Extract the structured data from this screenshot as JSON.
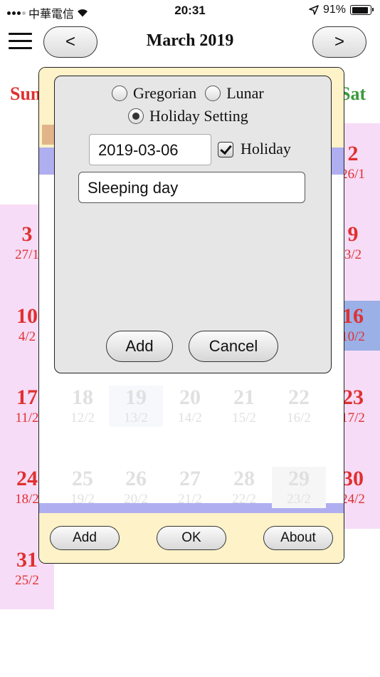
{
  "status_bar": {
    "carrier": "中華電信",
    "time": "20:31",
    "battery": "91%",
    "battery_level": 0.91
  },
  "header": {
    "prev_label": "<",
    "next_label": ">",
    "title": "March 2019"
  },
  "calendar": {
    "dow_sun": "Sun",
    "dow_sat": "Sat",
    "colors": {
      "weekend_bg": "#f6dcf6",
      "holiday_red": "#e03030",
      "sat_green": "#3a9a3a",
      "highlight_blue": "#9ab0e6"
    },
    "sundays": [
      {
        "day": "3",
        "lunar": "27/1"
      },
      {
        "day": "10",
        "lunar": "4/2"
      },
      {
        "day": "17",
        "lunar": "11/2"
      },
      {
        "day": "24",
        "lunar": "18/2"
      },
      {
        "day": "31",
        "lunar": "25/2"
      }
    ],
    "saturdays": [
      {
        "day": "2",
        "lunar": "26/1"
      },
      {
        "day": "9",
        "lunar": "3/2"
      },
      {
        "day": "16",
        "lunar": "10/2"
      },
      {
        "day": "23",
        "lunar": "17/2"
      },
      {
        "day": "30",
        "lunar": "24/2"
      }
    ],
    "faded_weeks": [
      [
        {
          "day": "18",
          "lunar": "12/2"
        },
        {
          "day": "19",
          "lunar": "13/2"
        },
        {
          "day": "20",
          "lunar": "14/2"
        },
        {
          "day": "21",
          "lunar": "15/2"
        },
        {
          "day": "22",
          "lunar": "16/2"
        }
      ],
      [
        {
          "day": "25",
          "lunar": "19/2"
        },
        {
          "day": "26",
          "lunar": "20/2"
        },
        {
          "day": "27",
          "lunar": "21/2"
        },
        {
          "day": "28",
          "lunar": "22/2"
        },
        {
          "day": "29",
          "lunar": "23/2"
        }
      ]
    ]
  },
  "dialog": {
    "add_label": "Add",
    "ok_label": "OK",
    "about_label": "About"
  },
  "holiday_dialog": {
    "radio_gregorian": "Gregorian",
    "radio_lunar": "Lunar",
    "radio_holiday_setting": "Holiday Setting",
    "selected": "Holiday Setting",
    "date_value": "2019-03-06",
    "holiday_checkbox_label": "Holiday",
    "holiday_checked": true,
    "description_value": "Sleeping day",
    "add_label": "Add",
    "cancel_label": "Cancel"
  }
}
